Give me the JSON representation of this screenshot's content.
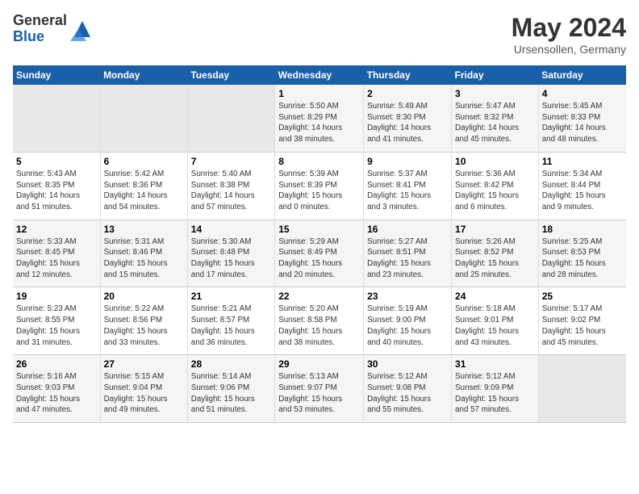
{
  "logo": {
    "general": "General",
    "blue": "Blue"
  },
  "header": {
    "month_year": "May 2024",
    "location": "Ursensollen, Germany"
  },
  "weekdays": [
    "Sunday",
    "Monday",
    "Tuesday",
    "Wednesday",
    "Thursday",
    "Friday",
    "Saturday"
  ],
  "weeks": [
    [
      {
        "day": "",
        "info": ""
      },
      {
        "day": "",
        "info": ""
      },
      {
        "day": "",
        "info": ""
      },
      {
        "day": "1",
        "info": "Sunrise: 5:50 AM\nSunset: 8:29 PM\nDaylight: 14 hours\nand 38 minutes."
      },
      {
        "day": "2",
        "info": "Sunrise: 5:49 AM\nSunset: 8:30 PM\nDaylight: 14 hours\nand 41 minutes."
      },
      {
        "day": "3",
        "info": "Sunrise: 5:47 AM\nSunset: 8:32 PM\nDaylight: 14 hours\nand 45 minutes."
      },
      {
        "day": "4",
        "info": "Sunrise: 5:45 AM\nSunset: 8:33 PM\nDaylight: 14 hours\nand 48 minutes."
      }
    ],
    [
      {
        "day": "5",
        "info": "Sunrise: 5:43 AM\nSunset: 8:35 PM\nDaylight: 14 hours\nand 51 minutes."
      },
      {
        "day": "6",
        "info": "Sunrise: 5:42 AM\nSunset: 8:36 PM\nDaylight: 14 hours\nand 54 minutes."
      },
      {
        "day": "7",
        "info": "Sunrise: 5:40 AM\nSunset: 8:38 PM\nDaylight: 14 hours\nand 57 minutes."
      },
      {
        "day": "8",
        "info": "Sunrise: 5:39 AM\nSunset: 8:39 PM\nDaylight: 15 hours\nand 0 minutes."
      },
      {
        "day": "9",
        "info": "Sunrise: 5:37 AM\nSunset: 8:41 PM\nDaylight: 15 hours\nand 3 minutes."
      },
      {
        "day": "10",
        "info": "Sunrise: 5:36 AM\nSunset: 8:42 PM\nDaylight: 15 hours\nand 6 minutes."
      },
      {
        "day": "11",
        "info": "Sunrise: 5:34 AM\nSunset: 8:44 PM\nDaylight: 15 hours\nand 9 minutes."
      }
    ],
    [
      {
        "day": "12",
        "info": "Sunrise: 5:33 AM\nSunset: 8:45 PM\nDaylight: 15 hours\nand 12 minutes."
      },
      {
        "day": "13",
        "info": "Sunrise: 5:31 AM\nSunset: 8:46 PM\nDaylight: 15 hours\nand 15 minutes."
      },
      {
        "day": "14",
        "info": "Sunrise: 5:30 AM\nSunset: 8:48 PM\nDaylight: 15 hours\nand 17 minutes."
      },
      {
        "day": "15",
        "info": "Sunrise: 5:29 AM\nSunset: 8:49 PM\nDaylight: 15 hours\nand 20 minutes."
      },
      {
        "day": "16",
        "info": "Sunrise: 5:27 AM\nSunset: 8:51 PM\nDaylight: 15 hours\nand 23 minutes."
      },
      {
        "day": "17",
        "info": "Sunrise: 5:26 AM\nSunset: 8:52 PM\nDaylight: 15 hours\nand 25 minutes."
      },
      {
        "day": "18",
        "info": "Sunrise: 5:25 AM\nSunset: 8:53 PM\nDaylight: 15 hours\nand 28 minutes."
      }
    ],
    [
      {
        "day": "19",
        "info": "Sunrise: 5:23 AM\nSunset: 8:55 PM\nDaylight: 15 hours\nand 31 minutes."
      },
      {
        "day": "20",
        "info": "Sunrise: 5:22 AM\nSunset: 8:56 PM\nDaylight: 15 hours\nand 33 minutes."
      },
      {
        "day": "21",
        "info": "Sunrise: 5:21 AM\nSunset: 8:57 PM\nDaylight: 15 hours\nand 36 minutes."
      },
      {
        "day": "22",
        "info": "Sunrise: 5:20 AM\nSunset: 8:58 PM\nDaylight: 15 hours\nand 38 minutes."
      },
      {
        "day": "23",
        "info": "Sunrise: 5:19 AM\nSunset: 9:00 PM\nDaylight: 15 hours\nand 40 minutes."
      },
      {
        "day": "24",
        "info": "Sunrise: 5:18 AM\nSunset: 9:01 PM\nDaylight: 15 hours\nand 43 minutes."
      },
      {
        "day": "25",
        "info": "Sunrise: 5:17 AM\nSunset: 9:02 PM\nDaylight: 15 hours\nand 45 minutes."
      }
    ],
    [
      {
        "day": "26",
        "info": "Sunrise: 5:16 AM\nSunset: 9:03 PM\nDaylight: 15 hours\nand 47 minutes."
      },
      {
        "day": "27",
        "info": "Sunrise: 5:15 AM\nSunset: 9:04 PM\nDaylight: 15 hours\nand 49 minutes."
      },
      {
        "day": "28",
        "info": "Sunrise: 5:14 AM\nSunset: 9:06 PM\nDaylight: 15 hours\nand 51 minutes."
      },
      {
        "day": "29",
        "info": "Sunrise: 5:13 AM\nSunset: 9:07 PM\nDaylight: 15 hours\nand 53 minutes."
      },
      {
        "day": "30",
        "info": "Sunrise: 5:12 AM\nSunset: 9:08 PM\nDaylight: 15 hours\nand 55 minutes."
      },
      {
        "day": "31",
        "info": "Sunrise: 5:12 AM\nSunset: 9:09 PM\nDaylight: 15 hours\nand 57 minutes."
      },
      {
        "day": "",
        "info": ""
      }
    ]
  ]
}
